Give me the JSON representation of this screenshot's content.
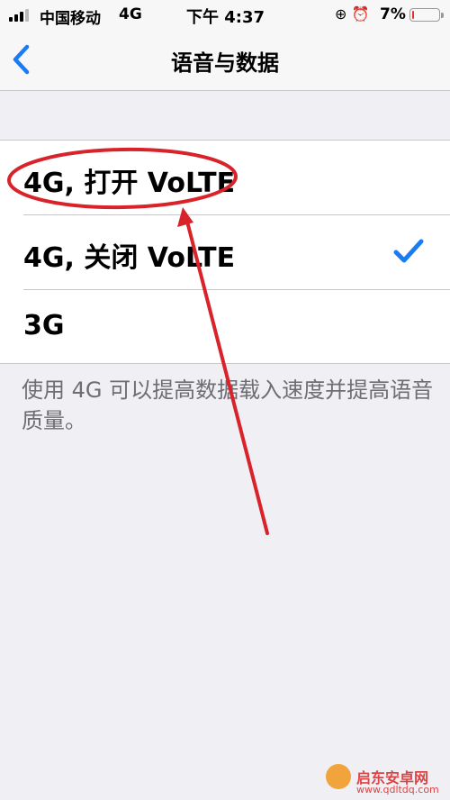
{
  "status_bar": {
    "carrier": "中国移动",
    "network": "4G",
    "time": "下午 4:37",
    "icons": "⊕ ⏰",
    "battery_text": "7%",
    "battery_level": 0.07
  },
  "nav": {
    "title": "语音与数据",
    "back_icon": "chevron-left-icon"
  },
  "options": [
    {
      "label": "4G, 打开 VoLTE",
      "selected": false
    },
    {
      "label": "4G, 关闭 VoLTE",
      "selected": true
    },
    {
      "label": "3G",
      "selected": false
    }
  ],
  "footer_text": "使用 4G 可以提高数据载入速度并提高语音质量。",
  "watermark": {
    "title": "启东安卓网",
    "url": "www.qdltdq.com"
  },
  "colors": {
    "accent": "#1a7cf5",
    "annotation": "#d9232b",
    "background": "#efeff4"
  }
}
